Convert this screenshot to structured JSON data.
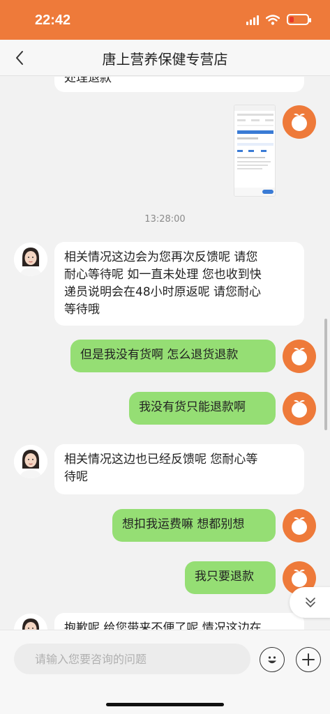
{
  "status_bar": {
    "time": "22:42"
  },
  "nav": {
    "title": "唐上营养保健专营店"
  },
  "messages": {
    "m0": "处理退款",
    "timestamp": "13:28:00",
    "m1_line1": "相关情况这边会为您再次反馈呢 请您",
    "m1_line2": "耐心等待呢 如一直未处理 您也收到快",
    "m1_line3": "递员说明会在48小时原返呢 请您耐心",
    "m1_line4": "等待哦",
    "m2": "但是我没有货啊 怎么退货退款",
    "m3": "我没有货只能退款啊",
    "m4_line1": "相关情况这边也已经反馈呢 您耐心等",
    "m4_line2": "待呢",
    "m5": "想扣我运费嘛 想都别想",
    "m6": "我只要退款",
    "m7": "抱歉呢 给您带来不便了呢 情况这边在"
  },
  "input": {
    "placeholder": "请输入您要咨询的问题"
  },
  "icons": {
    "back": "chevron-left-icon",
    "emoji": "smiley-icon",
    "add": "plus-icon",
    "scroll_down": "double-chevron-down-icon",
    "user_avatar": "orange-fruit-icon"
  },
  "colors": {
    "brand": "#ee7a3a",
    "sent_bubble": "#95de74",
    "received_bubble": "#ffffff",
    "background": "#f2f2f2"
  }
}
